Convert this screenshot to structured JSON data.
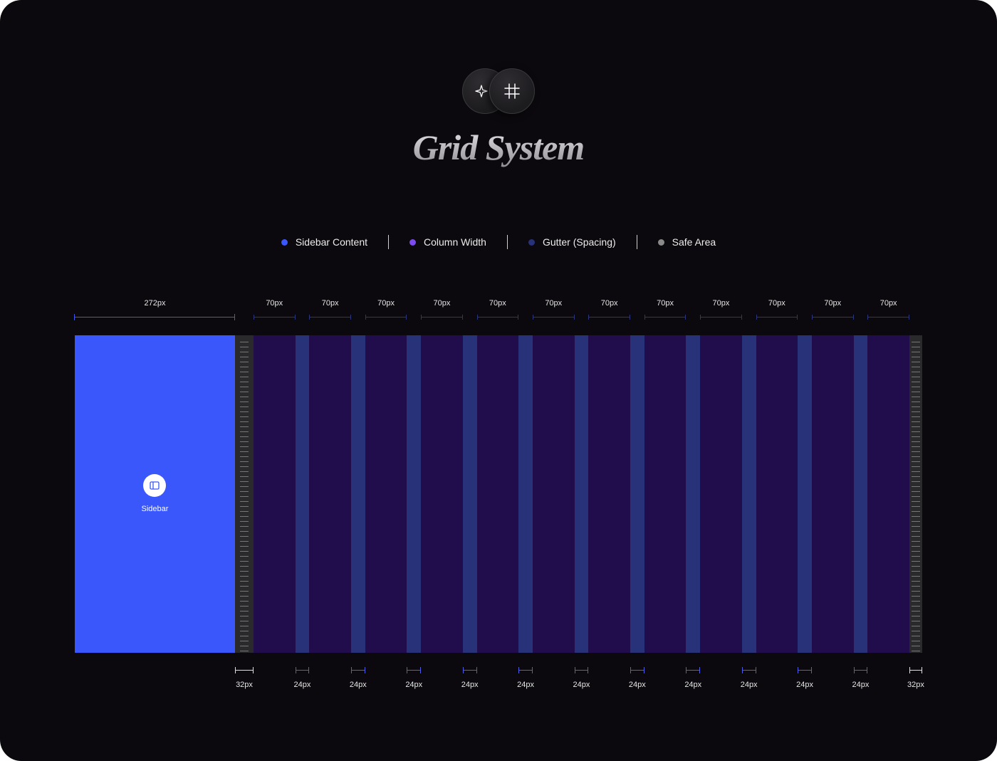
{
  "header": {
    "icons": [
      "sparkle-icon",
      "grid-hash-icon"
    ],
    "title": "Grid System"
  },
  "legend": [
    {
      "label": "Sidebar Content",
      "color": "#3a57fb"
    },
    {
      "label": "Column Width",
      "color": "#7b4af0"
    },
    {
      "label": "Gutter (Spacing)",
      "color": "#283279"
    },
    {
      "label": "Safe Area",
      "color": "#8a8a8a"
    }
  ],
  "grid": {
    "sidebar": {
      "label": "Sidebar",
      "icon": "sidebar-panel-icon",
      "width_label": "272px",
      "color": "#3a57fb"
    },
    "column_labels": [
      "70px",
      "70px",
      "70px",
      "70px",
      "70px",
      "70px",
      "70px",
      "70px",
      "70px",
      "70px",
      "70px",
      "70px"
    ],
    "gutter_labels": [
      "24px",
      "24px",
      "24px",
      "24px",
      "24px",
      "24px",
      "24px",
      "24px",
      "24px",
      "24px",
      "24px"
    ],
    "safe_area_labels": [
      "32px",
      "32px"
    ],
    "colors": {
      "column": "#210c4c",
      "gutter": "#283279",
      "safe_area": "#2a2a2c",
      "background": "#0b090d"
    }
  }
}
